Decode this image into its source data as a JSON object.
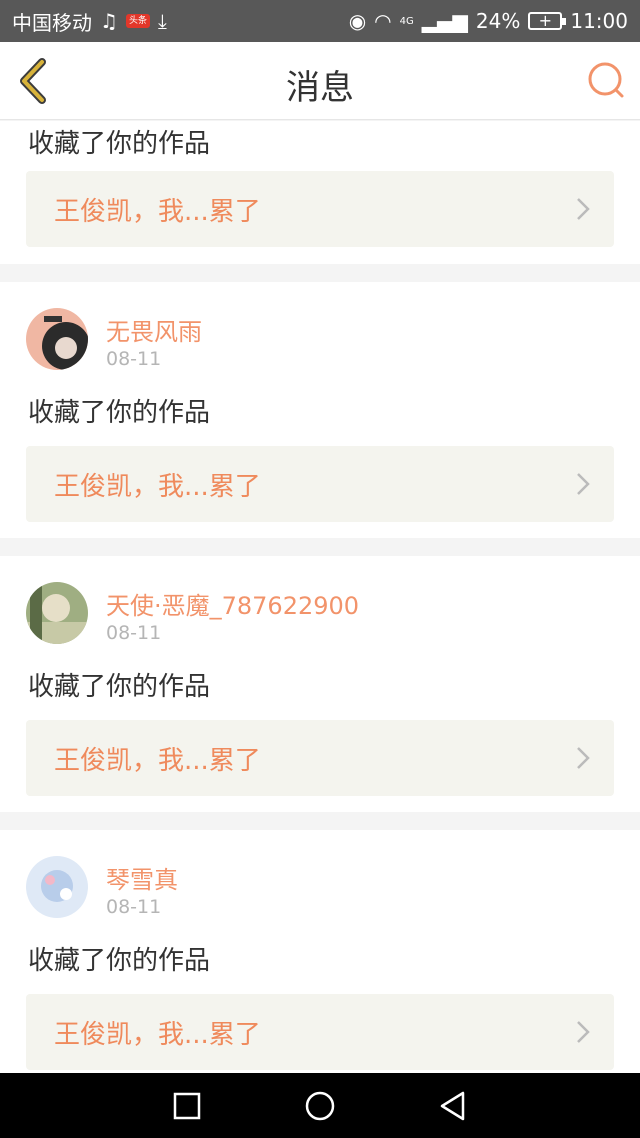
{
  "status_bar": {
    "carrier": "中国移动",
    "news_badge": "头条",
    "network": "4G",
    "battery": "24%",
    "time": "11:00"
  },
  "header": {
    "title": "消息"
  },
  "messages": [
    {
      "action": "收藏了你的作品",
      "work": "王俊凯，我...累了"
    },
    {
      "user": "无畏风雨",
      "date": "08-11",
      "action": "收藏了你的作品",
      "work": "王俊凯，我...累了"
    },
    {
      "user": "天使·恶魔_787622900",
      "date": "08-11",
      "action": "收藏了你的作品",
      "work": "王俊凯，我...累了"
    },
    {
      "user": "琴雪真",
      "date": "08-11",
      "action": "收藏了你的作品",
      "work": "王俊凯，我...累了"
    }
  ],
  "colors": {
    "accent": "#f2936a",
    "work_text": "#ef8a5c",
    "work_bg": "#f4f4ee",
    "back_icon": "#d8b33a"
  }
}
